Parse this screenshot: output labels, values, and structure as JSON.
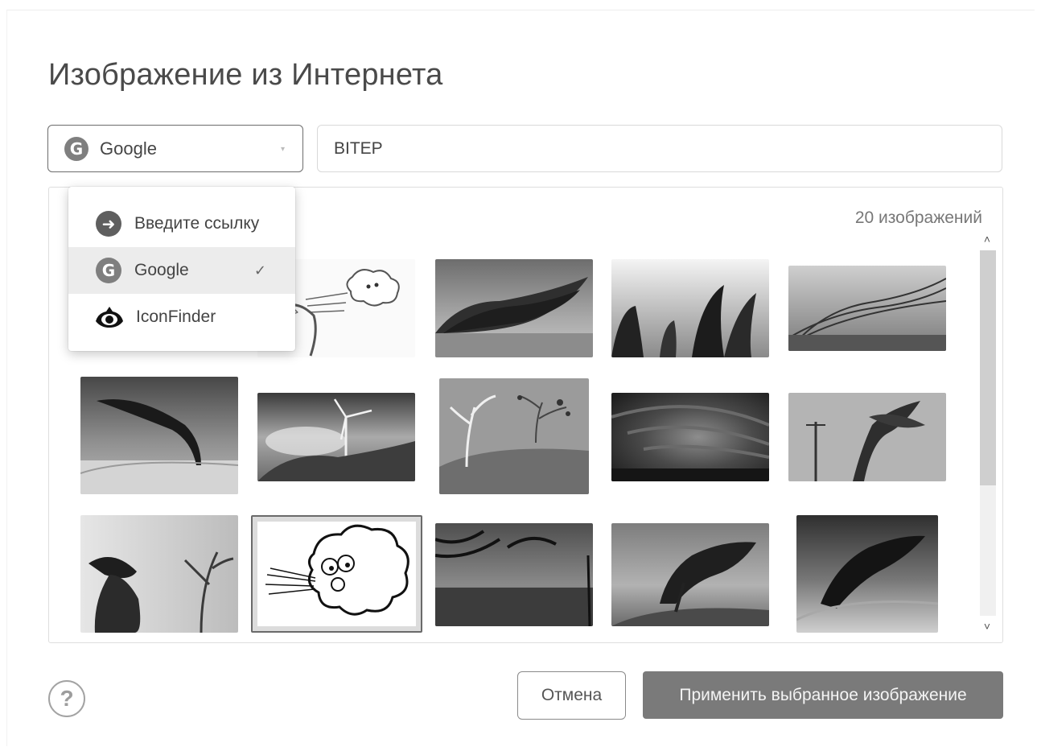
{
  "dialog": {
    "title": "Изображение из Интернета"
  },
  "provider_select": {
    "icon": "google-g-icon",
    "selected": "Google"
  },
  "search": {
    "value": "ВІТЕР"
  },
  "dropdown": {
    "items": [
      {
        "label": "Введите ссылку",
        "icon": "arrow-right-circle-icon",
        "checked": false
      },
      {
        "label": "Google",
        "icon": "google-g-icon",
        "checked": true
      },
      {
        "label": "IconFinder",
        "icon": "iconfinder-eye-icon",
        "checked": false
      }
    ],
    "check_glyph": "✓"
  },
  "results": {
    "count_text": "20 изображений",
    "images": [
      {
        "subject": "cartoon cloud blowing on tree"
      },
      {
        "subject": "bent trees on windy plain"
      },
      {
        "subject": "reeds in fog"
      },
      {
        "subject": "grass in wind"
      },
      {
        "subject": "wind-bent tree on grassland"
      },
      {
        "subject": "wind turbine over grass"
      },
      {
        "subject": "cartoon tree in storm"
      },
      {
        "subject": "storm cloud over sea"
      },
      {
        "subject": "tree beside power pole"
      },
      {
        "subject": "person with blowing hair"
      },
      {
        "subject": "cartoon cloud blowing",
        "selected": true
      },
      {
        "subject": "palms on windy beach"
      },
      {
        "subject": "tree bent by wind on hill"
      },
      {
        "subject": "windswept tree in grass"
      }
    ]
  },
  "scrollbar": {
    "up_glyph": "˄",
    "down_glyph": "˅"
  },
  "footer": {
    "help_glyph": "?",
    "cancel_label": "Отмена",
    "apply_label": "Применить выбранное изображение"
  },
  "colors": {
    "primary_button": "#7a7a7a",
    "border_dark": "#6c6c6c",
    "active_item": "#ececec"
  }
}
